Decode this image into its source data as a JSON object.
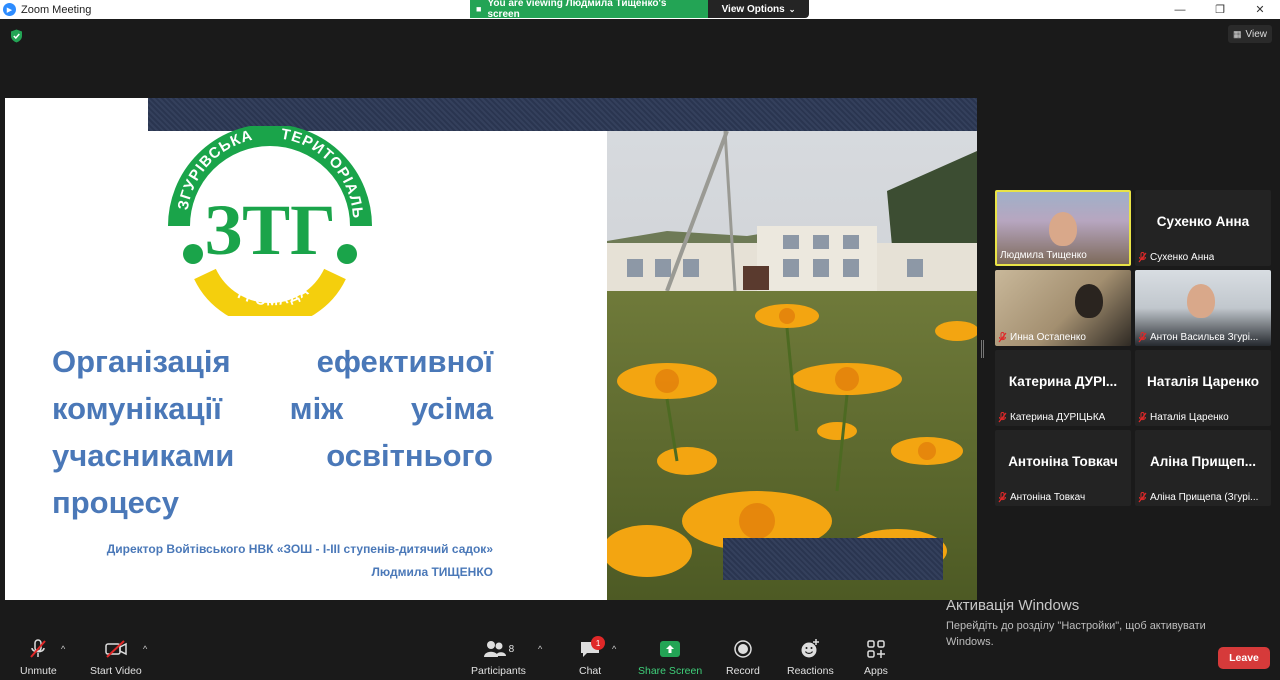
{
  "window": {
    "app_title": "Zoom Meeting",
    "controls": {
      "minimize": "—",
      "maximize": "❐",
      "close": "✕"
    }
  },
  "share_banner": {
    "status": "You are viewing Людмила Тищенко's screen",
    "view_options": "View Options"
  },
  "view_button": "View",
  "slide": {
    "title": "Організація ефективної комунікації між усіма учасниками освітнього процесу",
    "subtitle_1": "Директор Войтівського НВК «ЗОШ - І-ІІІ ступенів-дитячий садок»",
    "subtitle_2": "Людмила ТИЩЕНКО",
    "logo": {
      "top_left_arc": "ЗГУРІВСЬКА",
      "top_right_arc": "ТЕРИТОРІАЛЬНА",
      "bottom_arc": "ГРОМАДА",
      "monogram": "ЗТГ"
    }
  },
  "participants": [
    {
      "name": "",
      "label": "Людмила Тищенко",
      "video": true,
      "active": true
    },
    {
      "name": "Сухенко Анна",
      "label": "Сухенко Анна",
      "video": false
    },
    {
      "name": "",
      "label": "Инна Остапенко",
      "video": true
    },
    {
      "name": "",
      "label": "Антон Васильєв Згурі...",
      "video": true
    },
    {
      "name": "Катерина ДУРІ...",
      "label": "Катерина ДУРІЦЬКА",
      "video": false
    },
    {
      "name": "Наталія Царенко",
      "label": "Наталія Царенко",
      "video": false
    },
    {
      "name": "Антоніна Товкач",
      "label": "Антоніна Товкач",
      "video": false
    },
    {
      "name": "Аліна Прищеп...",
      "label": "Аліна Прищепа (Згурі...",
      "video": false
    }
  ],
  "activation": {
    "title": "Активація Windows",
    "text": "Перейдіть до розділу \"Настройки\", щоб активувати Windows."
  },
  "toolbar": {
    "unmute": "Unmute",
    "start_video": "Start Video",
    "participants": "Participants",
    "participants_count": "8",
    "chat": "Chat",
    "chat_badge": "1",
    "share_screen": "Share Screen",
    "record": "Record",
    "reactions": "Reactions",
    "apps": "Apps",
    "leave": "Leave"
  },
  "colors": {
    "zoom_blue": "#2d8cff",
    "share_green": "#23a455",
    "leave_red": "#d63a3a",
    "active_speaker": "#e9e346",
    "slide_text": "#4a78b8"
  }
}
